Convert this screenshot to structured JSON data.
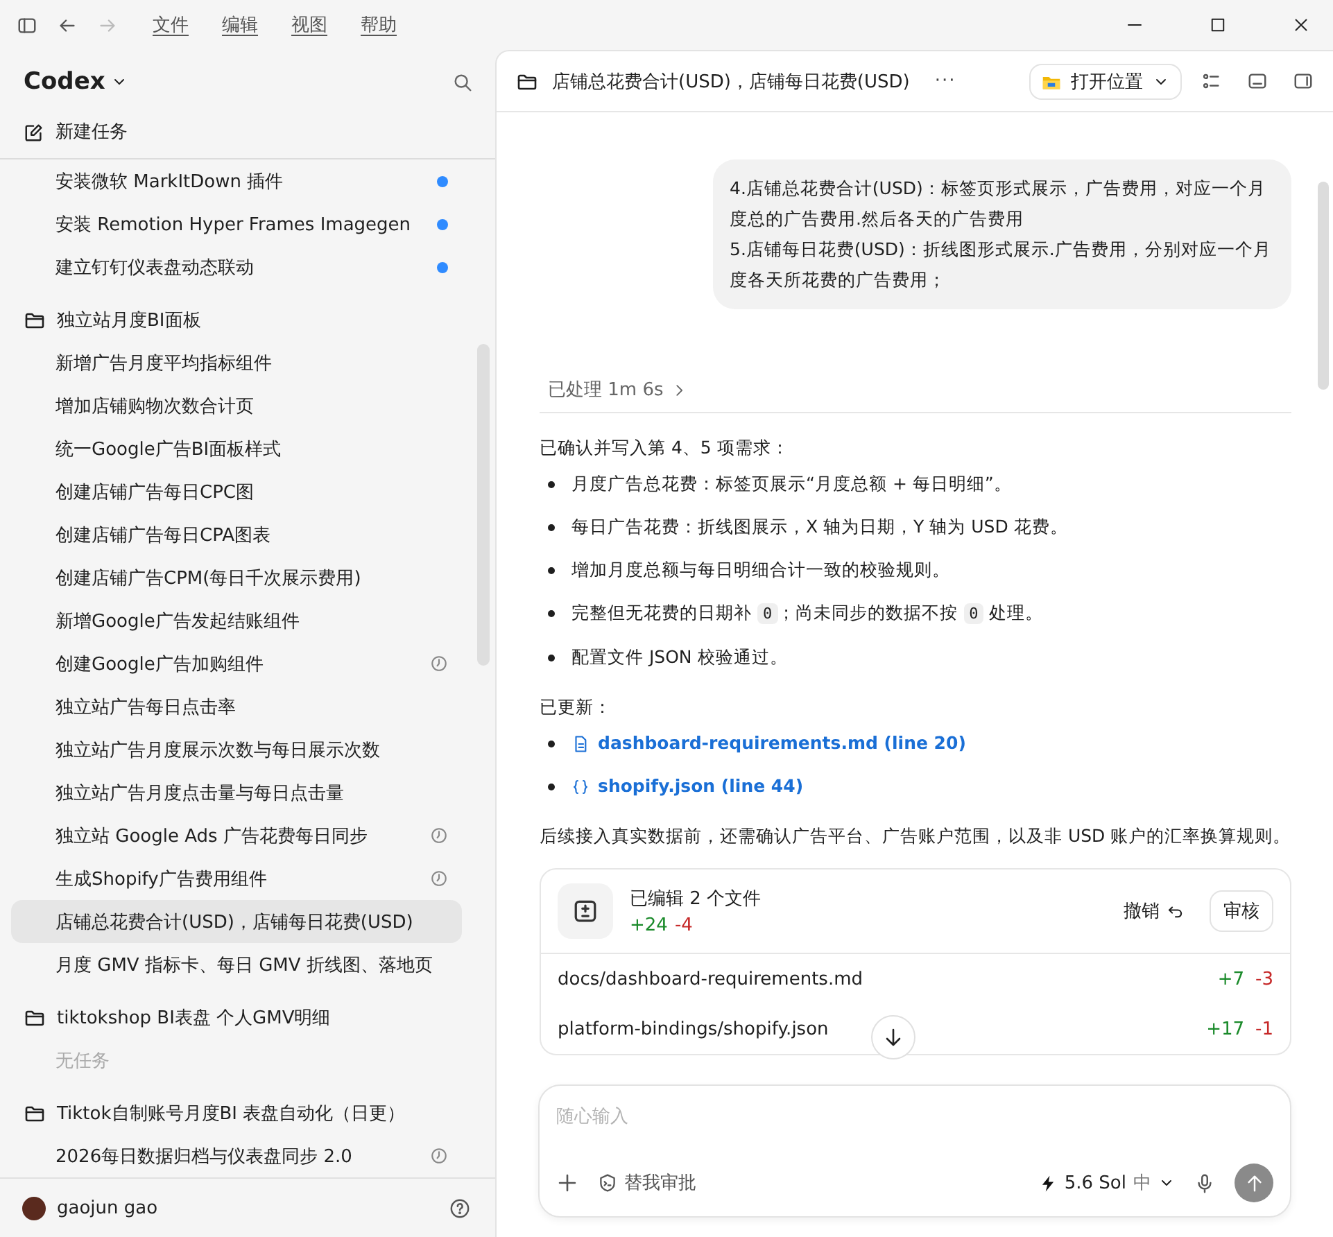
{
  "menu": [
    "文件",
    "编辑",
    "视图",
    "帮助"
  ],
  "sidebar": {
    "title": "Codex",
    "new_task": "新建任务",
    "tasks": [
      {
        "label": "安装微软 MarkItDown 插件",
        "kind": "dot",
        "selected": false
      },
      {
        "label": "安装 Remotion Hyper Frames Imagegen",
        "kind": "dot",
        "selected": false
      },
      {
        "label": "建立钉钉仪表盘动态联动",
        "kind": "dot",
        "selected": false
      }
    ],
    "projects": [
      {
        "name": "独立站月度BI面板",
        "tasks": [
          {
            "label": "新增广告月度平均指标组件",
            "kind": "plain",
            "selected": false
          },
          {
            "label": "增加店铺购物次数合计页",
            "kind": "plain",
            "selected": false
          },
          {
            "label": "统一Google广告BI面板样式",
            "kind": "plain",
            "selected": false
          },
          {
            "label": "创建店铺广告每日CPC图",
            "kind": "plain",
            "selected": false
          },
          {
            "label": "创建店铺广告每日CPA图表",
            "kind": "plain",
            "selected": false
          },
          {
            "label": "创建店铺广告CPM(每日千次展示费用)",
            "kind": "plain",
            "selected": false
          },
          {
            "label": "新增Google广告发起结账组件",
            "kind": "plain",
            "selected": false
          },
          {
            "label": "创建Google广告加购组件",
            "kind": "clock",
            "selected": false
          },
          {
            "label": "独立站广告每日点击率",
            "kind": "plain",
            "selected": false
          },
          {
            "label": "独立站广告月度展示次数与每日展示次数",
            "kind": "plain",
            "selected": false
          },
          {
            "label": "独立站广告月度点击量与每日点击量",
            "kind": "plain",
            "selected": false
          },
          {
            "label": "独立站 Google Ads 广告花费每日同步",
            "kind": "clock",
            "selected": false
          },
          {
            "label": "生成Shopify广告费用组件",
            "kind": "clock",
            "selected": false
          },
          {
            "label": "店铺总花费合计(USD)，店铺每日花费(USD)",
            "kind": "plain",
            "selected": true
          },
          {
            "label": "月度 GMV 指标卡、每日 GMV 折线图、落地页",
            "kind": "plain",
            "selected": false
          }
        ]
      },
      {
        "name": "tiktokshop BI表盘 个人GMV明细",
        "empty": "无任务"
      },
      {
        "name": "Tiktok自制账号月度BI 表盘自动化（日更）",
        "tasks": [
          {
            "label": "2026每日数据归档与仪表盘同步 2.0",
            "kind": "clock",
            "selected": false
          }
        ]
      }
    ],
    "user": "gaojun gao"
  },
  "header": {
    "title": "店铺总花费合计(USD)，店铺每日花费(USD)",
    "more": "···",
    "open_button": "打开位置"
  },
  "user_message": [
    "4.店铺总花费合计(USD)：标签页形式展示，广告费用，对应一个月度总的广告费用.然后各天的广告费用",
    "5.店铺每日花费(USD)：折线图形式展示.广告费用，分别对应一个月度各天所花费的广告费用；"
  ],
  "processed": "已处理 1m 6s",
  "reply": {
    "intro": "已确认并写入第 4、5 项需求：",
    "bullets": [
      [
        {
          "kind": "text",
          "text": "月度广告总花费：标签页展示“月度总额 + 每日明细”。"
        }
      ],
      [
        {
          "kind": "text",
          "text": "每日广告花费：折线图展示，X 轴为日期，Y 轴为 USD 花费。"
        }
      ],
      [
        {
          "kind": "text",
          "text": "增加月度总额与每日明细合计一致的校验规则。"
        }
      ],
      [
        {
          "kind": "text",
          "text": "完整但无花费的日期补 "
        },
        {
          "kind": "code",
          "text": "0"
        },
        {
          "kind": "text",
          "text": "；尚未同步的数据不按 "
        },
        {
          "kind": "code",
          "text": "0"
        },
        {
          "kind": "text",
          "text": " 处理。"
        }
      ],
      [
        {
          "kind": "text",
          "text": "配置文件 JSON 校验通过。"
        }
      ]
    ],
    "updated": "已更新：",
    "links": [
      {
        "kind": "file",
        "text": "dashboard-requirements.md (line 20)"
      },
      {
        "kind": "braces",
        "text": "shopify.json (line 44)"
      }
    ],
    "outro": "后续接入真实数据前，还需确认广告平台、广告账户范围，以及非 USD 账户的汇率换算规则。"
  },
  "edits": {
    "title": "已编辑 2 个文件",
    "added": "+24",
    "removed": "-4",
    "undo": "撤销",
    "review": "审核",
    "files": [
      {
        "path": "docs/dashboard-requirements.md",
        "added": "+7",
        "removed": "-3"
      },
      {
        "path": "platform-bindings/shopify.json",
        "added": "+17",
        "removed": "-1"
      }
    ]
  },
  "composer": {
    "placeholder": "随心输入",
    "approval": "替我审批",
    "model": "5.6 Sol",
    "effort": "中"
  }
}
